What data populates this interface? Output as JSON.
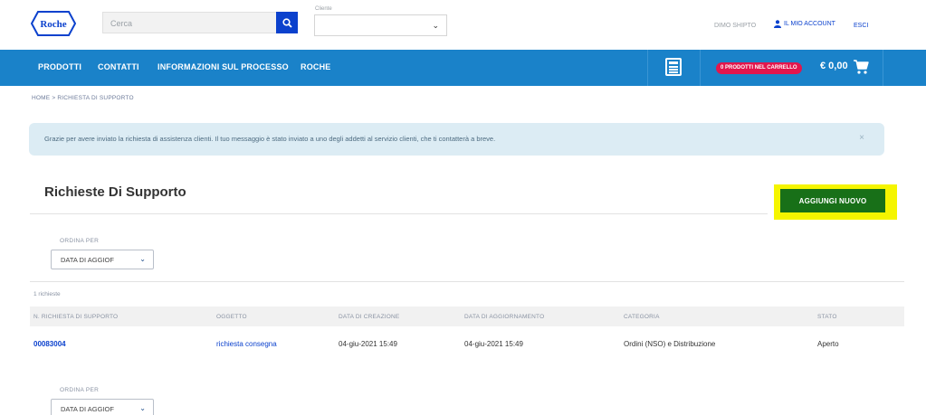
{
  "header": {
    "logo_text": "Roche",
    "search_placeholder": "Cerca",
    "client_label": "Cliente",
    "client_value": "",
    "shipto_label": "DIMO SHIPTO",
    "account_label": "IL MIO ACCOUNT",
    "logout_label": "ESCI"
  },
  "nav": {
    "items": [
      "PRODOTTI",
      "CONTATTI",
      "INFORMAZIONI SUL PROCESSO",
      "ROCHE"
    ],
    "cart_badge": "0 PRODOTTI NEL CARRELLO",
    "cart_total": "€ 0,00"
  },
  "breadcrumb": {
    "home": "HOME",
    "separator": ">",
    "current": "RICHIESTA DI SUPPORTO"
  },
  "alert": {
    "message": "Grazie per avere inviato la richiesta di assistenza clienti. Il tuo messaggio è stato inviato a uno degli addetti al servizio clienti, che ti contatterà a breve.",
    "close_symbol": "×"
  },
  "page": {
    "title": "Richieste Di Supporto",
    "add_button": "AGGIUNGI NUOVO",
    "sort_label": "ORDINA PER",
    "sort_value": "DATA DI AGGIOF",
    "count_text": "1 richieste"
  },
  "table": {
    "columns": [
      "N. RICHIESTA DI SUPPORTO",
      "OGGETTO",
      "DATA DI CREAZIONE",
      "DATA DI AGGIORNAMENTO",
      "CATEGORIA",
      "STATO"
    ],
    "rows": [
      {
        "number": "00083004",
        "subject": "richiesta consegna",
        "created": "04-giu-2021 15:49",
        "updated": "04-giu-2021 15:49",
        "category": "Ordini (NSO) e Distribuzione",
        "status": "Aperto"
      }
    ]
  },
  "colors": {
    "nav_blue": "#1a82c9",
    "brand_blue": "#0b41cd",
    "badge_pink": "#e2164d",
    "add_green": "#187018",
    "highlight_yellow": "#f5f500",
    "alert_bg": "#dcecf4"
  },
  "icons": [
    "roche-logo",
    "search-icon",
    "chevron-down-icon",
    "user-icon",
    "order-list-icon",
    "cart-icon",
    "close-icon"
  ]
}
